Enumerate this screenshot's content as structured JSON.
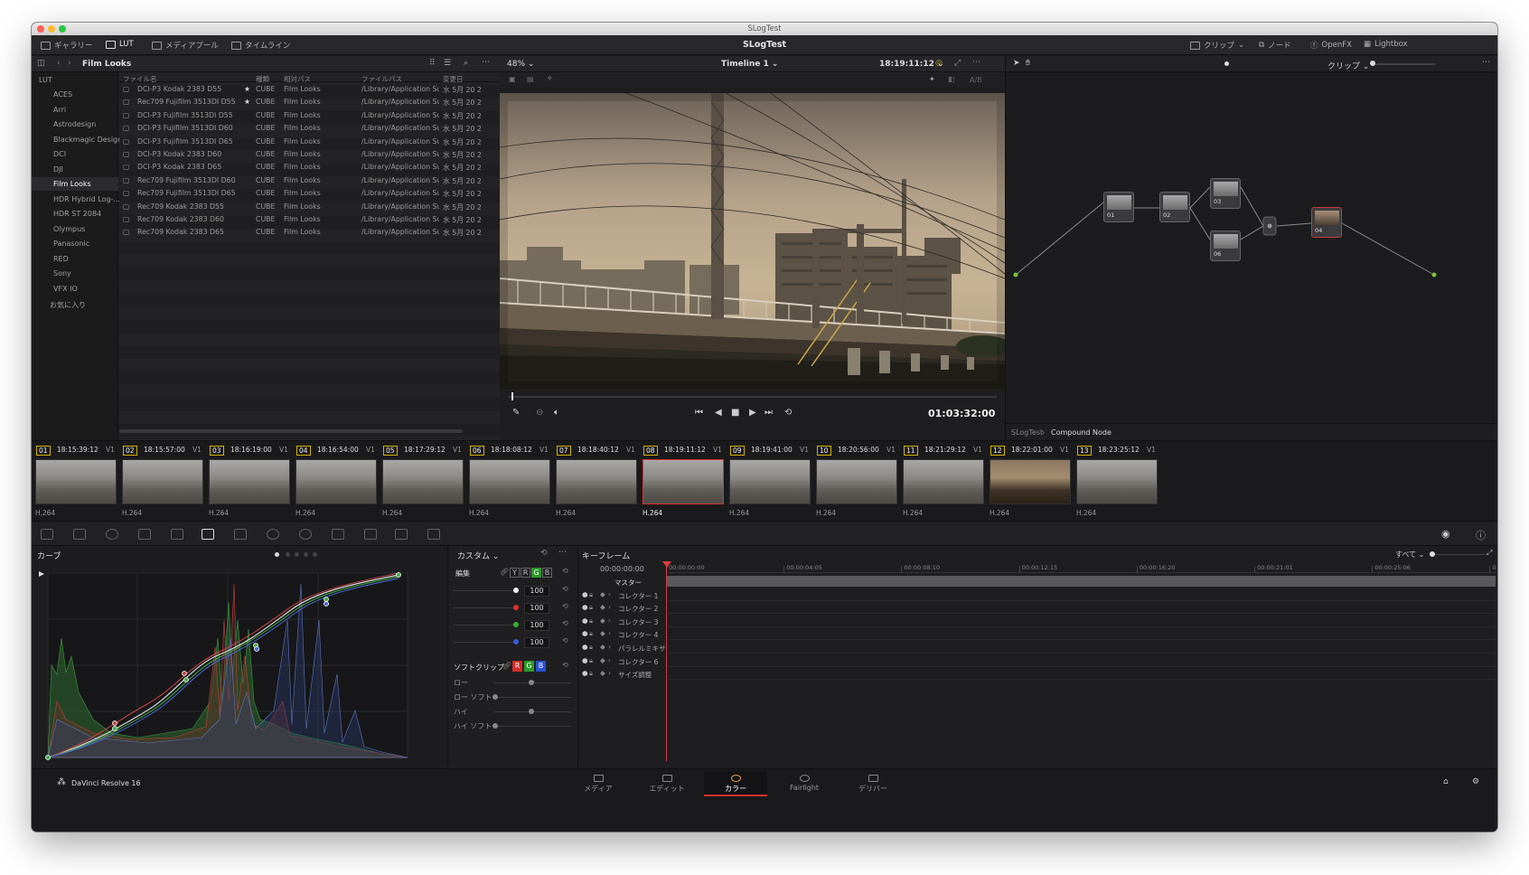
{
  "window_title": "SLogTest",
  "toolbar": {
    "gallery": "ギャラリー",
    "lut": "LUT",
    "media_pool": "メディアプール",
    "timeline": "タイムライン",
    "project": "SLogTest",
    "clip": "クリップ",
    "node": "ノード",
    "openfx": "OpenFX",
    "lightbox": "Lightbox"
  },
  "lut_browser": {
    "folder": "Film Looks",
    "columns": [
      "ファイル名",
      "種類",
      "相対パス",
      "ファイルパス",
      "変更日"
    ],
    "sidebar": [
      "LUT",
      "ACES",
      "Arri",
      "Astrodesign",
      "Blackmagic Design",
      "DCI",
      "DJI",
      "Film Looks",
      "HDR Hybrid Log-...",
      "HDR ST 2084",
      "Olympus",
      "Panasonic",
      "RED",
      "Sony",
      "VFX IO",
      "お気に入り"
    ],
    "rows": [
      {
        "name": "DCI-P3 Kodak 2383 D55",
        "star": "★",
        "type": "CUBE",
        "rel": "Film Looks",
        "path": "/Library/Application Su...",
        "date": "水 5月 20 2"
      },
      {
        "name": "Rec709 Fujifilm 3513DI D55",
        "star": "★",
        "type": "CUBE",
        "rel": "Film Looks",
        "path": "/Library/Application Su...",
        "date": "水 5月 20 2"
      },
      {
        "name": "DCI-P3 Fujifilm 3513DI D55",
        "star": "",
        "type": "CUBE",
        "rel": "Film Looks",
        "path": "/Library/Application Su...",
        "date": "水 5月 20 2"
      },
      {
        "name": "DCI-P3 Fujifilm 3513DI D60",
        "star": "",
        "type": "CUBE",
        "rel": "Film Looks",
        "path": "/Library/Application Su...",
        "date": "水 5月 20 2"
      },
      {
        "name": "DCI-P3 Fujifilm 3513DI D65",
        "star": "",
        "type": "CUBE",
        "rel": "Film Looks",
        "path": "/Library/Application Su...",
        "date": "水 5月 20 2"
      },
      {
        "name": "DCI-P3 Kodak 2383 D60",
        "star": "",
        "type": "CUBE",
        "rel": "Film Looks",
        "path": "/Library/Application Su...",
        "date": "水 5月 20 2"
      },
      {
        "name": "DCI-P3 Kodak 2383 D65",
        "star": "",
        "type": "CUBE",
        "rel": "Film Looks",
        "path": "/Library/Application Su...",
        "date": "水 5月 20 2"
      },
      {
        "name": "Rec709 Fujifilm 3513DI D60",
        "star": "",
        "type": "CUBE",
        "rel": "Film Looks",
        "path": "/Library/Application Su...",
        "date": "水 5月 20 2"
      },
      {
        "name": "Rec709 Fujifilm 3513DI D65",
        "star": "",
        "type": "CUBE",
        "rel": "Film Looks",
        "path": "/Library/Application Su...",
        "date": "水 5月 20 2"
      },
      {
        "name": "Rec709 Kodak 2383 D55",
        "star": "",
        "type": "CUBE",
        "rel": "Film Looks",
        "path": "/Library/Application Su...",
        "date": "水 5月 20 2"
      },
      {
        "name": "Rec709 Kodak 2383 D60",
        "star": "",
        "type": "CUBE",
        "rel": "Film Looks",
        "path": "/Library/Application Su...",
        "date": "水 5月 20 2"
      },
      {
        "name": "Rec709 Kodak 2383 D65",
        "star": "",
        "type": "CUBE",
        "rel": "Film Looks",
        "path": "/Library/Application Su...",
        "date": "水 5月 20 2"
      }
    ]
  },
  "viewer": {
    "zoom": "48%",
    "timeline_name": "Timeline 1",
    "timecode_top": "18:19:11:12",
    "ab": "A/B",
    "timecode": "01:03:32:00"
  },
  "node_editor": {
    "mode": "クリップ",
    "breadcrumb_root": "SLogTest",
    "breadcrumb_current": "Compound Node",
    "nodes": [
      "01",
      "02",
      "03",
      "06",
      "04"
    ]
  },
  "clips": [
    {
      "num": "01",
      "tc": "18:15:39:12",
      "track": "V1",
      "codec": "H.264",
      "color": "#d7b300"
    },
    {
      "num": "02",
      "tc": "18:15:57:00",
      "track": "V1",
      "codec": "H.264",
      "color": "#d7b300"
    },
    {
      "num": "03",
      "tc": "18:16:19:00",
      "track": "V1",
      "codec": "H.264",
      "color": "#d7b300"
    },
    {
      "num": "04",
      "tc": "18:16:54:00",
      "track": "V1",
      "codec": "H.264",
      "color": "#d7b300"
    },
    {
      "num": "05",
      "tc": "18:17:29:12",
      "track": "V1",
      "codec": "H.264",
      "color": "#d7b300"
    },
    {
      "num": "06",
      "tc": "18:18:08:12",
      "track": "V1",
      "codec": "H.264",
      "color": "#d7b300"
    },
    {
      "num": "07",
      "tc": "18:18:40:12",
      "track": "V1",
      "codec": "H.264",
      "color": "#d7b300"
    },
    {
      "num": "08",
      "tc": "18:19:11:12",
      "track": "V1",
      "codec": "H.264",
      "color": "#d7b300"
    },
    {
      "num": "09",
      "tc": "18:19:41:00",
      "track": "V1",
      "codec": "H.264",
      "color": "#d7b300"
    },
    {
      "num": "10",
      "tc": "18:20:56:00",
      "track": "V1",
      "codec": "H.264",
      "color": "#d7b300"
    },
    {
      "num": "11",
      "tc": "18:21:29:12",
      "track": "V1",
      "codec": "H.264",
      "color": "#d7b300"
    },
    {
      "num": "12",
      "tc": "18:22:01:00",
      "track": "V1",
      "codec": "H.264",
      "color": "#d7b300"
    },
    {
      "num": "13",
      "tc": "18:23:25:12",
      "track": "V1",
      "codec": "H.264",
      "color": "#d7b300"
    }
  ],
  "curves": {
    "title": "カーブ",
    "mode": "カスタム",
    "edit_label": "編集",
    "channels": [
      "Y",
      "R",
      "G",
      "B"
    ],
    "intensities": [
      "100",
      "100",
      "100",
      "100"
    ],
    "soft_clip": "ソフトクリップ",
    "soft_params": [
      "ロー",
      "ロー ソフト",
      "ハイ",
      "ハイ ソフト"
    ]
  },
  "keyframes": {
    "title": "キーフレーム",
    "filter": "すべて",
    "timecode": "00:00:00:00",
    "ruler": [
      "00:00:00:00",
      "00:00:04:05",
      "00:00:08:10",
      "00:00:12:15",
      "00:00:16:20",
      "00:00:21:01",
      "00:00:25:06",
      "0"
    ],
    "tracks": [
      "マスター",
      "コレクター 1",
      "コレクター 2",
      "コレクター 3",
      "コレクター 4",
      "パラレルミキサ",
      "コレクター 6",
      "サイズ調整"
    ]
  },
  "footer": {
    "app": "DaVinci Resolve 16",
    "pages": [
      "メディア",
      "エディット",
      "カラー",
      "Fairlight",
      "デリバー"
    ]
  }
}
